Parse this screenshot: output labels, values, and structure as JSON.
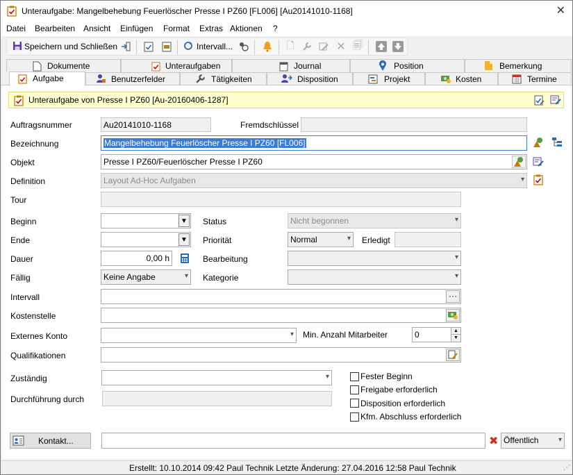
{
  "window": {
    "title": "Unteraufgabe: Mangelbehebung Feuerlöscher Presse I PZ60 [FL006] [Au20141010-1168]"
  },
  "menu": [
    "Datei",
    "Bearbeiten",
    "Ansicht",
    "Einfügen",
    "Format",
    "Extras",
    "Aktionen",
    "?"
  ],
  "toolbar": {
    "save_close": "Speichern und Schließen",
    "interval": "Intervall..."
  },
  "tabs_back": [
    "Dokumente",
    "Unteraufgaben",
    "Journal",
    "Position",
    "Bemerkung"
  ],
  "tabs_front": [
    "Aufgabe",
    "Benutzerfelder",
    "Tätigkeiten",
    "Disposition",
    "Projekt",
    "Kosten",
    "Termine"
  ],
  "banner": "Unteraufgabe von Presse I PZ60 [Au-20160406-1287]",
  "labels": {
    "auftragsnummer": "Auftragsnummer",
    "fremdschluessel": "Fremdschlüssel",
    "bezeichnung": "Bezeichnung",
    "objekt": "Objekt",
    "definition": "Definition",
    "tour": "Tour",
    "beginn": "Beginn",
    "status": "Status",
    "ende": "Ende",
    "prioritaet": "Priorität",
    "erledigt": "Erledigt",
    "dauer": "Dauer",
    "bearbeitung": "Bearbeitung",
    "faellig": "Fällig",
    "kategorie": "Kategorie",
    "intervall": "Intervall",
    "kostenstelle": "Kostenstelle",
    "externes_konto": "Externes Konto",
    "min_mitarbeiter": "Min. Anzahl Mitarbeiter",
    "qualifikationen": "Qualifikationen",
    "zustaendig": "Zuständig",
    "durchfuehrung": "Durchführung durch"
  },
  "values": {
    "auftragsnummer": "Au20141010-1168",
    "bezeichnung": "Mangelbehebung Feuerlöscher Presse I PZ60 [FL006]",
    "objekt": "Presse I PZ60/Feuerlöscher Presse I PZ60",
    "definition": "Layout Ad-Hoc Aufgaben",
    "status": "Nicht begonnen",
    "prioritaet": "Normal",
    "dauer": "0,00 h",
    "faellig": "Keine Angabe",
    "min_mitarbeiter": "0",
    "oeffentlich": "Öffentlich"
  },
  "checkboxes": [
    "Fester Beginn",
    "Freigabe erforderlich",
    "Disposition erforderlich",
    "Kfm. Abschluss erforderlich"
  ],
  "contact_button": "Kontakt...",
  "statusbar": "Erstellt: 10.10.2014 09:42 Paul Technik  Letzte Änderung: 27.04.2016 12:58 Paul Technik",
  "icons": [
    "task-icon",
    "close-icon",
    "save-icon",
    "exit-icon",
    "interval-icon",
    "bell-icon",
    "wrench-icon",
    "delete-icon",
    "arrow-up-icon",
    "arrow-down-icon",
    "calculator-icon",
    "ellipsis-icon",
    "contact-card-icon",
    "red-x-icon"
  ]
}
